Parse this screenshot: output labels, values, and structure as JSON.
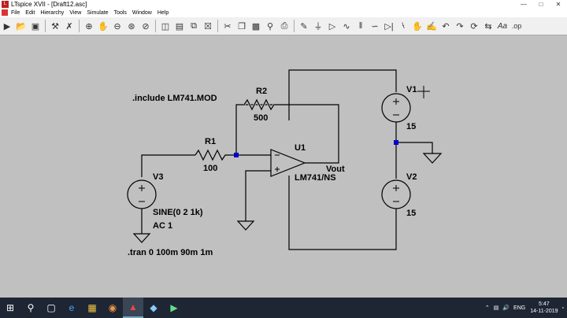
{
  "window": {
    "title": "LTspice XVII - [Draft12.asc]"
  },
  "menu": [
    "File",
    "Edit",
    "Hierarchy",
    "View",
    "Simulate",
    "Tools",
    "Window",
    "Help"
  ],
  "toolbar_icons": [
    "run-icon",
    "open-icon",
    "save-icon",
    "control-panel-icon",
    "halt-icon",
    "zoom-in-icon",
    "pan-icon",
    "zoom-out-icon",
    "zoom-fit-icon",
    "autoscale-icon",
    "tile-vertical-icon",
    "tile-horizontal-icon",
    "cascade-icon",
    "close-window-icon",
    "cut-icon",
    "copy-icon",
    "paste-icon",
    "find-icon",
    "print-icon",
    "wire-icon",
    "ground-icon",
    "label-icon",
    "resistor-icon",
    "capacitor-icon",
    "inductor-icon",
    "diode-icon",
    "component-icon",
    "move-icon",
    "drag-icon",
    "undo-icon",
    "redo-icon",
    "rotate-icon",
    "mirror-icon",
    "text-icon",
    "spice-directive-icon"
  ],
  "schematic": {
    "include": ".include LM741.MOD",
    "R2": {
      "name": "R2",
      "value": "500"
    },
    "R1": {
      "name": "R1",
      "value": "100"
    },
    "U1": {
      "name": "U1",
      "model": "LM741/NS"
    },
    "out_label": "Vout",
    "V1": {
      "name": "V1",
      "value": "15"
    },
    "V2": {
      "name": "V2",
      "value": "15"
    },
    "V3": {
      "name": "V3",
      "value1": "SINE(0 2 1k)",
      "value2": "AC 1"
    },
    "tran": ".tran 0 100m 90m 1m"
  },
  "taskbar": {
    "apps": [
      "start-icon",
      "search-icon",
      "task-view-icon",
      "edge-icon",
      "file-explorer-icon",
      "chrome-icon",
      "ltspice-icon",
      "app-icon",
      "app2-icon"
    ],
    "lang": "ENG",
    "time": "5:47",
    "date": "14-11-2019"
  }
}
